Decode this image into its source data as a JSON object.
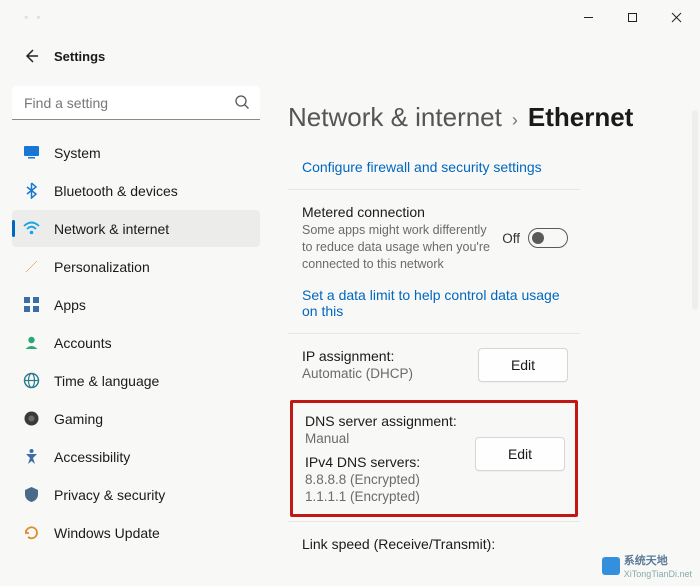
{
  "window": {
    "app_title": "Settings"
  },
  "search": {
    "placeholder": "Find a setting"
  },
  "sidebar": {
    "items": [
      {
        "label": "System"
      },
      {
        "label": "Bluetooth & devices"
      },
      {
        "label": "Network & internet"
      },
      {
        "label": "Personalization"
      },
      {
        "label": "Apps"
      },
      {
        "label": "Accounts"
      },
      {
        "label": "Time & language"
      },
      {
        "label": "Gaming"
      },
      {
        "label": "Accessibility"
      },
      {
        "label": "Privacy & security"
      },
      {
        "label": "Windows Update"
      }
    ]
  },
  "breadcrumb": {
    "parent": "Network & internet",
    "current": "Ethernet"
  },
  "content": {
    "firewall_link": "Configure firewall and security settings",
    "metered": {
      "title": "Metered connection",
      "sub": "Some apps might work differently to reduce data usage when you're connected to this network",
      "state": "Off"
    },
    "data_limit_link": "Set a data limit to help control data usage on this",
    "ip": {
      "label": "IP assignment:",
      "value": "Automatic (DHCP)",
      "edit": "Edit"
    },
    "dns": {
      "label": "DNS server assignment:",
      "value": "Manual",
      "servers_label": "IPv4 DNS servers:",
      "server1": "8.8.8.8 (Encrypted)",
      "server2": "1.1.1.1 (Encrypted)",
      "edit": "Edit"
    },
    "link_speed_label": "Link speed (Receive/Transmit):"
  },
  "watermark": {
    "text_cn": "系统天地",
    "text_en": "XiTongTianDi.net"
  }
}
